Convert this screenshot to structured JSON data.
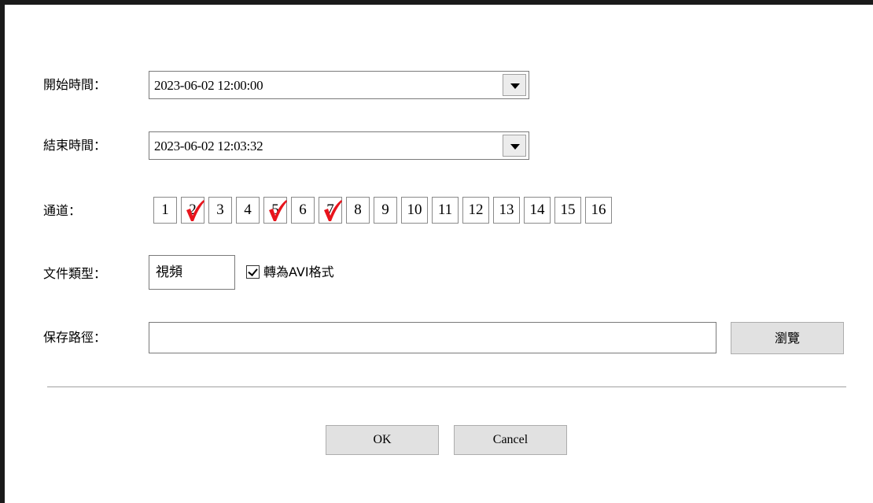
{
  "form": {
    "start_label": "開始時間：",
    "start_value": "2023-06-02 12:00:00",
    "end_label": "結束時間：",
    "end_value": "2023-06-02 12:03:32",
    "channel_label": "通道：",
    "channels": [
      {
        "label": "1",
        "checked": false
      },
      {
        "label": "2",
        "checked": true
      },
      {
        "label": "3",
        "checked": false
      },
      {
        "label": "4",
        "checked": false
      },
      {
        "label": "5",
        "checked": true
      },
      {
        "label": "6",
        "checked": false
      },
      {
        "label": "7",
        "checked": true
      },
      {
        "label": "8",
        "checked": false
      },
      {
        "label": "9",
        "checked": false
      },
      {
        "label": "10",
        "checked": false
      },
      {
        "label": "11",
        "checked": false
      },
      {
        "label": "12",
        "checked": false
      },
      {
        "label": "13",
        "checked": false
      },
      {
        "label": "14",
        "checked": false
      },
      {
        "label": "15",
        "checked": false
      },
      {
        "label": "16",
        "checked": false
      }
    ],
    "filetype_label": "文件類型：",
    "filetype_value": "視頻",
    "avi_checkbox_label": "轉為AVI格式",
    "avi_checked": true,
    "savepath_label": "保存路徑：",
    "savepath_value": "",
    "browse_label": "瀏覽"
  },
  "actions": {
    "ok_label": "OK",
    "cancel_label": "Cancel"
  },
  "colors": {
    "check_mark": "#e8141c",
    "button_bg": "#e1e1e1"
  }
}
